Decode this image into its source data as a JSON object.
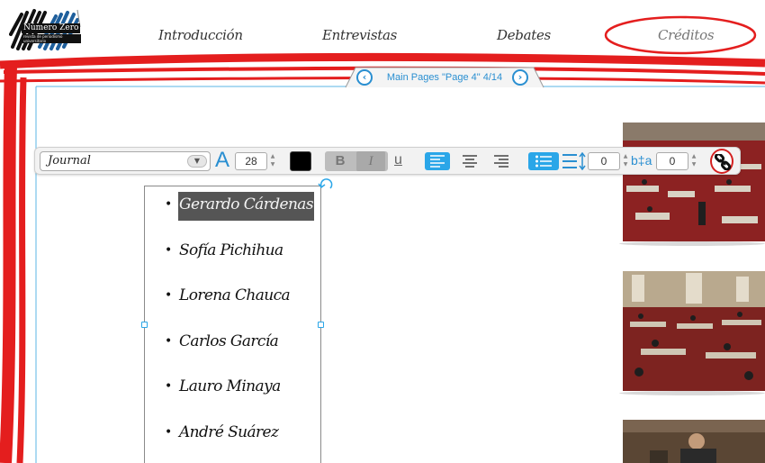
{
  "logo": {
    "title": "Número Zero",
    "subtitle": "revista de periodismo universitario"
  },
  "nav": {
    "items": [
      {
        "label": "Introducción"
      },
      {
        "label": "Entrevistas"
      },
      {
        "label": "Debates"
      },
      {
        "label": "Créditos",
        "active": true
      }
    ]
  },
  "pager": {
    "label": "Main Pages \"Page 4\" 4/14",
    "prev_icon": "chevron-left-icon",
    "next_icon": "chevron-right-icon"
  },
  "toolbar": {
    "font_family": "Journal",
    "font_size": "28",
    "text_color": "#000000",
    "bold_label": "B",
    "italic_label": "I",
    "underline_label": "u",
    "size_icon_label": "A",
    "line_spacing": "0",
    "indent_icon_label": "b‡a",
    "indent": "0",
    "accent_color": "#2aa6e8"
  },
  "credits": {
    "names": [
      "Gerardo Cárdenas",
      "Sofía Pichihua",
      "Lorena Chauca",
      "Carlos García",
      "Lauro Minaya",
      "André Suárez"
    ],
    "bullet": "•"
  },
  "colors": {
    "frame_red": "#e41e1e",
    "frame_blue": "#5bb6e6",
    "link_blue": "#2a8fd1"
  }
}
